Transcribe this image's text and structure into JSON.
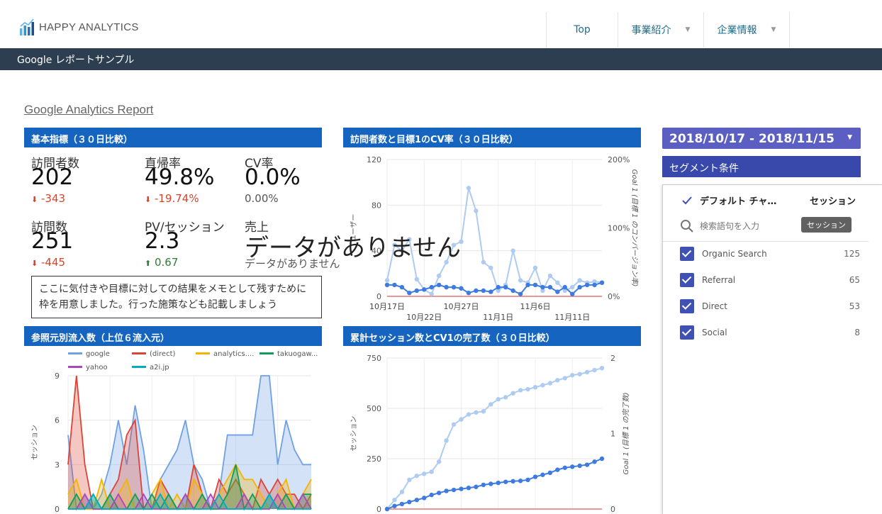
{
  "header": {
    "logo_text": "HAPPY ANALYTICS",
    "nav": [
      {
        "label": "Top"
      },
      {
        "label": "事業紹介"
      },
      {
        "label": "企業情報"
      }
    ]
  },
  "bluebar": {
    "title": "Google レポートサンプル"
  },
  "report_title": "Google Analytics Report",
  "kpi": {
    "heading": "基本指標（３０日比較）",
    "visitors": {
      "label": "訪問者数",
      "value": "202",
      "delta": "-343"
    },
    "bounce": {
      "label": "直帰率",
      "value": "49.8%",
      "delta": "-19.74%"
    },
    "cv": {
      "label": "CV率",
      "value": "0.0%",
      "delta": "0.00%"
    },
    "sessions": {
      "label": "訪問数",
      "value": "251",
      "delta": "-445"
    },
    "pvs": {
      "label": "PV/セッション",
      "value": "2.3",
      "delta": "0.67"
    },
    "sales": {
      "label": "売上",
      "nodata_big": "データがありません",
      "nodata": "データがありません"
    },
    "memo": "ここに気付きや目標に対しての結果をメモとして残すために枠を用意しました。行った施策なども記載しましょう"
  },
  "chart_titles": {
    "visitors_cv": "訪問者数と目標1のCV率（３０日比較）",
    "referrers": "参照元別流入数（上位６流入元）",
    "cumulative": "累計セッション数とCV1の完了数（３０日比較）"
  },
  "chart_data": [
    {
      "type": "line",
      "title": "訪問者数と目標1のCV率（３０日比較）",
      "x": [
        "10月17日",
        "10月18日",
        "10月19日",
        "10月20日",
        "10月21日",
        "10月22日",
        "10月23日",
        "10月24日",
        "10月25日",
        "10月26日",
        "10月27日",
        "10月28日",
        "10月29日",
        "10月30日",
        "10月31日",
        "11月1日",
        "11月2日",
        "11月3日",
        "11月4日",
        "11月5日",
        "11月6日",
        "11月7日",
        "11月8日",
        "11月9日",
        "11月10日",
        "11月11日",
        "11月12日",
        "11月13日",
        "11月14日",
        "11月15日"
      ],
      "x_tick_labels": [
        "10月17日",
        "10月22日",
        "10月27日",
        "11月1日",
        "11月6日",
        "11月11日"
      ],
      "ylabel": "ユーザー",
      "y2label": "Goal 1 (目標 1 のコンバージョン率)",
      "ylim": [
        0,
        120
      ],
      "y_ticks": [
        "0",
        "40",
        "80",
        "120"
      ],
      "y2_ticks": [
        "0%",
        "100%",
        "200%"
      ],
      "series": [
        {
          "values": [
            14,
            45,
            40,
            50,
            15,
            6,
            2,
            18,
            30,
            45,
            48,
            95,
            75,
            30,
            25,
            5,
            10,
            40,
            14,
            12,
            25,
            5,
            18,
            12,
            5,
            8,
            14,
            12,
            13,
            12
          ]
        },
        {
          "values": [
            10,
            10,
            8,
            3,
            5,
            6,
            8,
            10,
            8,
            8,
            7,
            3,
            5,
            5,
            4,
            8,
            8,
            5,
            2,
            10,
            10,
            8,
            8,
            4,
            8,
            2,
            8,
            10,
            10,
            12
          ]
        },
        {
          "values": [
            0,
            0,
            0,
            0,
            0,
            0,
            0,
            0,
            0,
            0,
            0,
            0,
            0,
            0,
            0,
            0,
            0,
            0,
            0,
            0,
            0,
            0,
            0,
            0,
            0,
            0,
            0,
            0,
            0,
            0
          ],
          "axis": "right"
        }
      ]
    },
    {
      "type": "area",
      "title": "参照元別流入数（上位６流入元）",
      "ylabel": "セッション",
      "ylim": [
        0,
        9
      ],
      "y_ticks": [
        "0",
        "3",
        "6",
        "9"
      ],
      "series": [
        {
          "name": "google",
          "color": "#6fa0e6",
          "values": [
            5,
            0,
            1,
            0,
            1,
            3,
            6,
            3,
            7,
            4,
            0,
            2,
            3,
            4,
            6,
            3,
            2,
            0,
            1,
            5,
            5,
            5,
            5,
            9,
            9,
            3,
            6,
            4,
            3,
            3
          ]
        },
        {
          "name": "(direct)",
          "color": "#db4437",
          "values": [
            3,
            9,
            3,
            0,
            0,
            1,
            2,
            5,
            6,
            0,
            0,
            2,
            1,
            0,
            0,
            3,
            1,
            0,
            2,
            1,
            2,
            1,
            0,
            2,
            1,
            2,
            1,
            1,
            0,
            1
          ]
        },
        {
          "name": "analytics....",
          "color": "#f4b400",
          "values": [
            1,
            2,
            0,
            0,
            2,
            0,
            1,
            2,
            0,
            0,
            1,
            2,
            0,
            1,
            0,
            2,
            1,
            0,
            1,
            2,
            3,
            2,
            2,
            1,
            0,
            1,
            2,
            0,
            1,
            2
          ]
        },
        {
          "name": "takuogaw...",
          "color": "#0f9d58",
          "values": [
            0,
            1,
            0,
            1,
            0,
            1,
            0,
            0,
            1,
            0,
            1,
            0,
            1,
            0,
            1,
            0,
            1,
            0,
            0,
            1,
            3,
            0,
            1,
            0,
            1,
            0,
            1,
            0,
            1,
            1
          ]
        },
        {
          "name": "yahoo",
          "color": "#ab47bc",
          "values": [
            0,
            0,
            1,
            0,
            0,
            0,
            1,
            0,
            0,
            1,
            0,
            0,
            0,
            0,
            1,
            0,
            0,
            1,
            0,
            0,
            0,
            1,
            0,
            0,
            0,
            1,
            0,
            0,
            1,
            0
          ]
        },
        {
          "name": "a2i.jp",
          "color": "#00acc1",
          "values": [
            0,
            0,
            0,
            1,
            0,
            0,
            0,
            0,
            0,
            0,
            0,
            1,
            0,
            0,
            0,
            0,
            0,
            0,
            1,
            0,
            0,
            0,
            0,
            0,
            1,
            0,
            0,
            0,
            0,
            0
          ]
        }
      ]
    },
    {
      "type": "line",
      "title": "累計セッション数とCV1の完了数（３０日比較）",
      "ylabel": "セッション",
      "y2label": "Goal 1 (目標 1 の完了数)",
      "ylim": [
        0,
        750
      ],
      "y_ticks": [
        "0",
        "250",
        "500",
        "750"
      ],
      "y2_ticks": [
        "0",
        "1",
        "2"
      ],
      "series": [
        {
          "values": [
            0,
            45,
            85,
            145,
            165,
            175,
            185,
            235,
            340,
            420,
            445,
            470,
            480,
            485,
            520,
            545,
            555,
            575,
            590,
            595,
            605,
            615,
            625,
            640,
            650,
            665,
            670,
            680,
            690,
            700
          ]
        },
        {
          "values": [
            0,
            15,
            25,
            35,
            45,
            55,
            70,
            80,
            90,
            95,
            100,
            105,
            110,
            120,
            125,
            130,
            135,
            138,
            140,
            145,
            160,
            170,
            180,
            195,
            205,
            210,
            215,
            220,
            235,
            250
          ]
        },
        {
          "values": [
            0,
            0,
            0,
            0,
            0,
            0,
            0,
            0,
            0,
            0,
            0,
            0,
            0,
            0,
            0,
            0,
            0,
            0,
            0,
            0,
            0,
            0,
            0,
            0,
            0,
            0,
            0,
            0,
            0,
            0
          ],
          "axis": "right"
        }
      ]
    }
  ],
  "date_range": "2018/10/17 - 2018/11/15",
  "segment": {
    "heading": "セグメント条件",
    "default_label": "デフォルト チャ…",
    "column_label": "セッション",
    "search_placeholder": "検索語句を入力",
    "tooltip": "セッション",
    "items": [
      {
        "label": "Organic Search",
        "count": "125"
      },
      {
        "label": "Referral",
        "count": "65"
      },
      {
        "label": "Direct",
        "count": "53"
      },
      {
        "label": "Social",
        "count": "8"
      }
    ]
  },
  "colors": {
    "header_bar": "#2c3e4f",
    "panel_blue": "#1565c0",
    "date_bar": "#5a5fc1",
    "segment_bar": "#3949ab"
  }
}
